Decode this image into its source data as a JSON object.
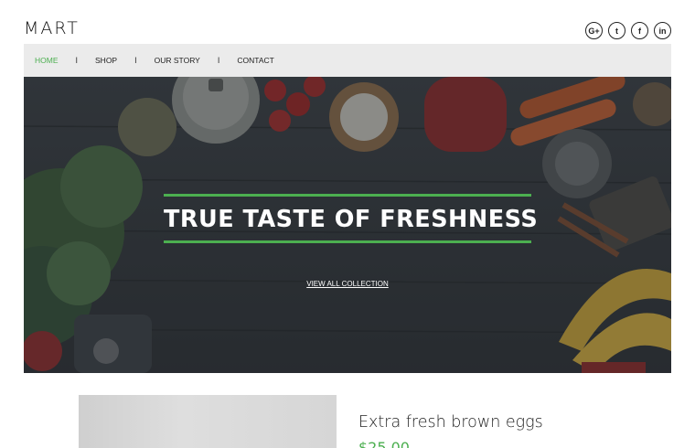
{
  "header": {
    "logo": "MART",
    "socials": [
      {
        "icon": "google-plus-icon",
        "glyph": "G+"
      },
      {
        "icon": "twitter-icon",
        "glyph": "t"
      },
      {
        "icon": "facebook-icon",
        "glyph": "f"
      },
      {
        "icon": "linkedin-icon",
        "glyph": "in"
      }
    ]
  },
  "nav": {
    "items": [
      {
        "label": "HOME",
        "active": true
      },
      {
        "label": "SHOP",
        "active": false
      },
      {
        "label": "OUR STORY",
        "active": false
      },
      {
        "label": "CONTACT",
        "active": false
      }
    ],
    "separator": "I"
  },
  "hero": {
    "title": "TRUE TASTE OF FRESHNESS",
    "cta": "VIEW ALL COLLECTION",
    "accent_color": "#4caf50"
  },
  "product": {
    "title": "Extra fresh brown eggs",
    "price": "$25.00"
  }
}
